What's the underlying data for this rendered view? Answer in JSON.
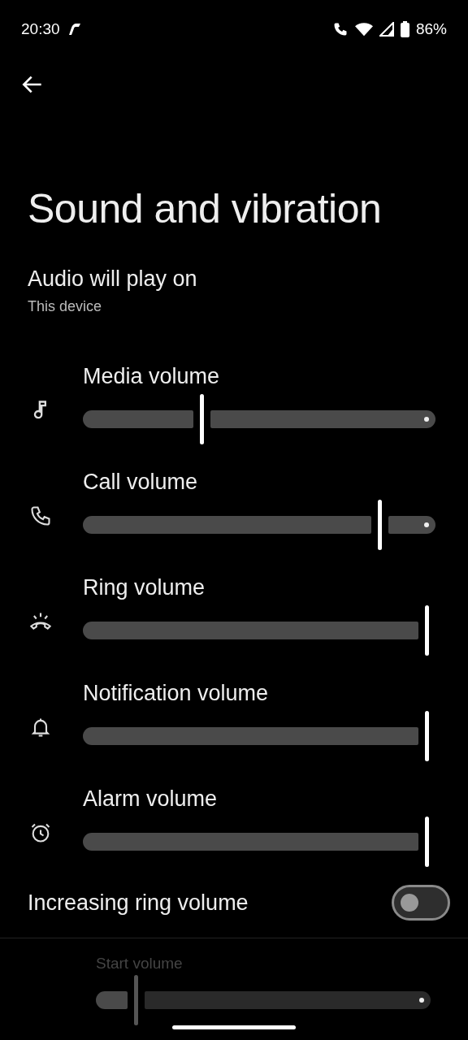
{
  "status_bar": {
    "time": "20:30",
    "battery": "86%"
  },
  "title": "Sound and vibration",
  "output": {
    "label": "Audio will play on",
    "value": "This device"
  },
  "volumes": [
    {
      "kind": "media",
      "label": "Media volume",
      "level": 0.33
    },
    {
      "kind": "call",
      "label": "Call volume",
      "level": 0.86
    },
    {
      "kind": "ring",
      "label": "Ring volume",
      "level": 1
    },
    {
      "kind": "notification",
      "label": "Notification volume",
      "level": 1
    },
    {
      "kind": "alarm",
      "label": "Alarm volume",
      "level": 1
    }
  ],
  "increasing_ring": {
    "label": "Increasing ring volume",
    "on": false
  },
  "start_volume": {
    "label": "Start volume",
    "level": 0.1,
    "disabled": true
  }
}
